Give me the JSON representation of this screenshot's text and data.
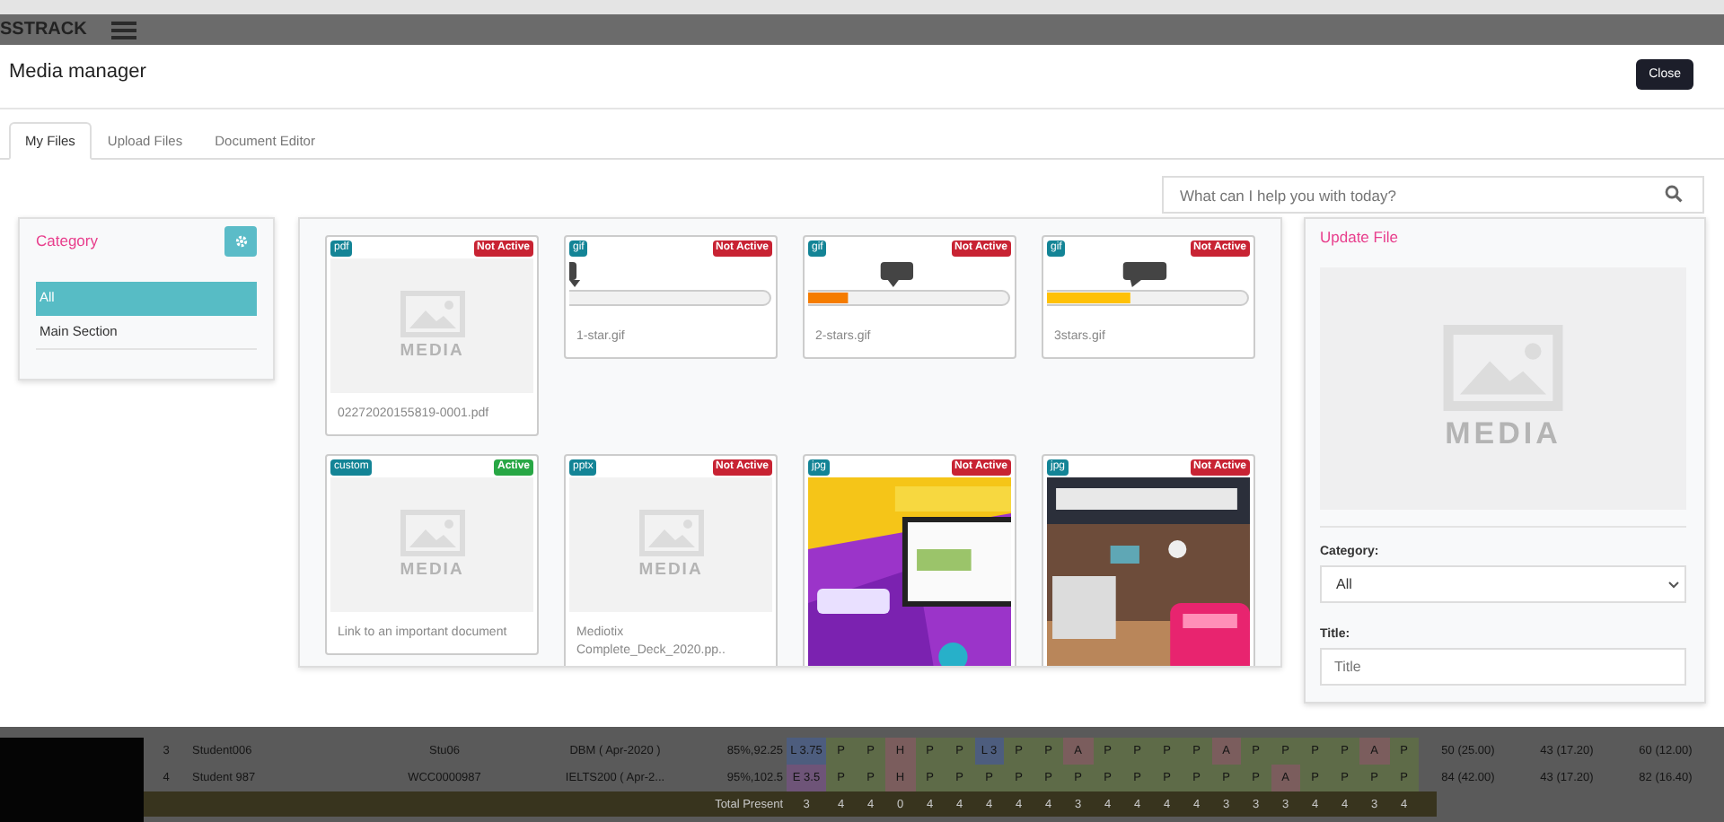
{
  "app_bar": {
    "logo": "SSTRACK"
  },
  "modal": {
    "title": "Media manager",
    "close_label": "Close",
    "tabs": [
      {
        "label": "My Files",
        "selected": true
      },
      {
        "label": "Upload Files",
        "selected": false
      },
      {
        "label": "Document Editor",
        "selected": false
      }
    ],
    "search": {
      "placeholder": "What can I help you with today?"
    },
    "category": {
      "title": "Category",
      "items": [
        {
          "label": "All",
          "selected": true
        },
        {
          "label": "Main Section",
          "selected": false
        }
      ]
    },
    "files": [
      {
        "type": "pdf",
        "status": "Not Active",
        "active": false,
        "kind": "media",
        "thumb_label": "MEDIA",
        "name": "02272020155819-0001.pdf"
      },
      {
        "type": "gif",
        "status": "Not Active",
        "active": false,
        "kind": "gif",
        "name": "1-star.gif"
      },
      {
        "type": "gif",
        "status": "Not Active",
        "active": false,
        "kind": "gif",
        "name": "2-stars.gif"
      },
      {
        "type": "gif",
        "status": "Not Active",
        "active": false,
        "kind": "gif",
        "name": "3stars.gif"
      },
      {
        "type": "custom",
        "status": "Active",
        "active": true,
        "kind": "media",
        "thumb_label": "MEDIA",
        "name": "Link to an important document"
      },
      {
        "type": "pptx",
        "status": "Not Active",
        "active": false,
        "kind": "media",
        "thumb_label": "MEDIA",
        "name": "Mediotix Complete_Deck_2020.pp.."
      },
      {
        "type": "jpg",
        "status": "Not Active",
        "active": false
      },
      {
        "type": "jpg",
        "status": "Not Active",
        "active": false
      }
    ],
    "update_file": {
      "title": "Update File",
      "preview_label": "MEDIA",
      "category_label": "Category:",
      "category_value": "All",
      "title_label": "Title:",
      "title_placeholder": "Title"
    }
  },
  "table": {
    "rows": [
      {
        "no": "3",
        "name": "Student006",
        "id": "Stu06",
        "course": "DBM ( Apr-2020 )",
        "score": "85%,92.25",
        "grade": {
          "text": "L 3.75",
          "color": "#4d5d7e"
        },
        "marks": [
          {
            "text": "P",
            "color": "#5e6b48"
          },
          {
            "text": "P",
            "color": "#5e6b48"
          },
          {
            "text": "H",
            "color": "#7b5d5d"
          },
          {
            "text": "P",
            "color": "#5e6b48"
          },
          {
            "text": "P",
            "color": "#5e6b48"
          },
          {
            "text": "L 3",
            "color": "#4d5d7e"
          },
          {
            "text": "P",
            "color": "#5e6b48"
          },
          {
            "text": "P",
            "color": "#5e6b48"
          },
          {
            "text": "A",
            "color": "#7b5d5d"
          },
          {
            "text": "P",
            "color": "#5e6b48"
          },
          {
            "text": "P",
            "color": "#5e6b48"
          },
          {
            "text": "P",
            "color": "#5e6b48"
          },
          {
            "text": "P",
            "color": "#5e6b48"
          },
          {
            "text": "A",
            "color": "#7b5d5d"
          },
          {
            "text": "P",
            "color": "#5e6b48"
          },
          {
            "text": "P",
            "color": "#5e6b48"
          },
          {
            "text": "P",
            "color": "#5e6b48"
          },
          {
            "text": "P",
            "color": "#5e6b48"
          },
          {
            "text": "A",
            "color": "#7b5d5d"
          },
          {
            "text": "P",
            "color": "#5e6b48"
          }
        ],
        "results": [
          "50 (25.00)",
          "43 (17.20)",
          "60 (12.00)"
        ]
      },
      {
        "no": "4",
        "name": "Student 987",
        "id": "WCC0000987",
        "course": "IELTS200 ( Apr-2...",
        "score": "95%,102.5",
        "grade": {
          "text": "E 3.5",
          "color": "#6e5478"
        },
        "marks": [
          {
            "text": "P",
            "color": "#5e6b48"
          },
          {
            "text": "P",
            "color": "#5e6b48"
          },
          {
            "text": "H",
            "color": "#7b5d5d"
          },
          {
            "text": "P",
            "color": "#5e6b48"
          },
          {
            "text": "P",
            "color": "#5e6b48"
          },
          {
            "text": "P",
            "color": "#5e6b48"
          },
          {
            "text": "P",
            "color": "#5e6b48"
          },
          {
            "text": "P",
            "color": "#5e6b48"
          },
          {
            "text": "P",
            "color": "#5e6b48"
          },
          {
            "text": "P",
            "color": "#5e6b48"
          },
          {
            "text": "P",
            "color": "#5e6b48"
          },
          {
            "text": "P",
            "color": "#5e6b48"
          },
          {
            "text": "P",
            "color": "#5e6b48"
          },
          {
            "text": "P",
            "color": "#5e6b48"
          },
          {
            "text": "P",
            "color": "#5e6b48"
          },
          {
            "text": "A",
            "color": "#7b5d5d"
          },
          {
            "text": "P",
            "color": "#5e6b48"
          },
          {
            "text": "P",
            "color": "#5e6b48"
          },
          {
            "text": "P",
            "color": "#5e6b48"
          },
          {
            "text": "P",
            "color": "#5e6b48"
          }
        ],
        "results": [
          "84 (42.00)",
          "43 (17.20)",
          "82 (16.40)"
        ]
      }
    ],
    "total": {
      "label": "Total Present",
      "values": [
        "3",
        "4",
        "4",
        "0",
        "4",
        "4",
        "4",
        "4",
        "4",
        "3",
        "4",
        "4",
        "4",
        "4",
        "3",
        "3",
        "3",
        "4",
        "4",
        "3",
        "4"
      ]
    }
  }
}
